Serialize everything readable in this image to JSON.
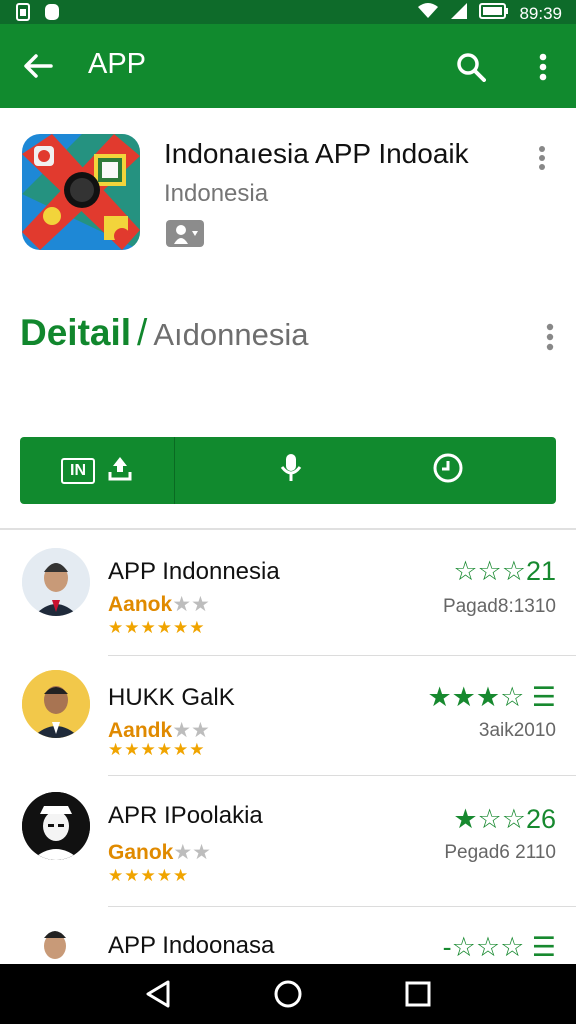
{
  "status_bar": {
    "time": "89:39",
    "icons": [
      "sim-card-icon",
      "notification-icon",
      "wifi-icon",
      "signal-icon",
      "battery-icon"
    ]
  },
  "app_bar": {
    "title": "APP",
    "back_icon": "back-arrow-icon",
    "search_icon": "search-icon",
    "overflow_icon": "more-vert-icon",
    "background": "#118a2e"
  },
  "app": {
    "name": "Indonaıesia APP Indoaik",
    "developer": "Indonesia",
    "badge_icon": "content-rating-icon"
  },
  "detail": {
    "title": "Deitail",
    "separator": "/",
    "subtitle": "Aıdonnesia"
  },
  "actions": [
    {
      "label": "IN",
      "icon": "install-icon"
    },
    {
      "label": "",
      "icon": "mic-icon"
    },
    {
      "label": "",
      "icon": "clock-icon"
    }
  ],
  "list": [
    {
      "title": "APP Indonnesia",
      "subtitle": "Aanok",
      "stars": "★★★★★★",
      "rating": "☆☆☆21",
      "meta": "Pagad8:1310"
    },
    {
      "title": "HUKK GalK",
      "subtitle": "Aandk",
      "stars": "★★★★★★",
      "rating": "★★★☆ ☰",
      "meta": "3aik2010"
    },
    {
      "title": "APR IPoolakia",
      "subtitle": "Ganok",
      "stars": "★★★★★",
      "rating": "★☆☆26",
      "meta": "Pegad6 2110"
    },
    {
      "title": "APP Indoonasa",
      "subtitle": "",
      "stars": "",
      "rating": "-☆☆☆ ☰",
      "meta": ""
    }
  ],
  "nav": {
    "back_icon": "nav-back-icon",
    "home_icon": "nav-home-icon",
    "recents_icon": "nav-recents-icon"
  },
  "colors": {
    "primary": "#118a2e",
    "status": "#0e6b2a",
    "accent_gold": "#f0a400"
  }
}
